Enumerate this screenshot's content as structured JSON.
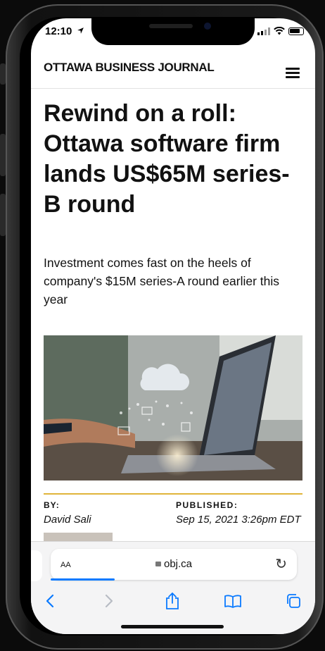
{
  "status_bar": {
    "time": "12:10"
  },
  "site": {
    "logo": "OTTAWA BUSINESS JOURNAL"
  },
  "article": {
    "headline": "Rewind on a roll: Ottawa software firm lands US$65M series-B round",
    "dek": "Investment comes fast on the heels of company's $15M series-A round earlier this year",
    "byline_label": "BY:",
    "author": "David Sali",
    "published_label": "PUBLISHED:",
    "published_date": "Sep 15, 2021 3:26pm EDT"
  },
  "browser": {
    "text_size_label": "AA",
    "url": "obj.ca",
    "page_load_progress": 0.26
  },
  "colors": {
    "accent_rule": "#e0b43a",
    "safari_blue": "#0a7aff"
  },
  "icons": [
    "location-arrow-icon",
    "wifi-icon",
    "battery-icon",
    "hamburger-menu-icon",
    "lock-icon",
    "reload-icon",
    "back-icon",
    "forward-icon",
    "share-icon",
    "bookmarks-icon",
    "tabs-icon"
  ]
}
